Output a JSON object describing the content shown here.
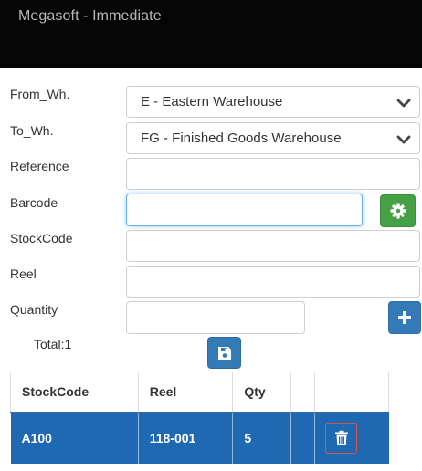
{
  "window": {
    "title": "Megasoft - Immediate"
  },
  "form": {
    "from_wh": {
      "label": "From_Wh.",
      "value": "E - Eastern Warehouse"
    },
    "to_wh": {
      "label": "To_Wh.",
      "value": "FG - Finished Goods Warehouse"
    },
    "reference": {
      "label": "Reference",
      "value": ""
    },
    "barcode": {
      "label": "Barcode",
      "value": ""
    },
    "stockcode": {
      "label": "StockCode",
      "value": ""
    },
    "reel": {
      "label": "Reel",
      "value": ""
    },
    "quantity": {
      "label": "Quantity",
      "value": ""
    }
  },
  "total": {
    "text": "Total:1"
  },
  "table": {
    "headers": [
      "StockCode",
      "Reel",
      "Qty",
      "",
      ""
    ],
    "rows": [
      {
        "stockcode": "A100",
        "reel": "118-001",
        "qty": "5"
      }
    ]
  },
  "icons": {
    "settings": "gear-icon",
    "add": "plus-icon",
    "save": "save-icon",
    "delete": "trash-icon",
    "dropdown": "chevron-down-icon"
  },
  "colors": {
    "titlebar": "#050505",
    "primary": "#337ab7",
    "success": "#46a046",
    "row_selected": "#1f69b3",
    "danger": "#d9534f"
  }
}
